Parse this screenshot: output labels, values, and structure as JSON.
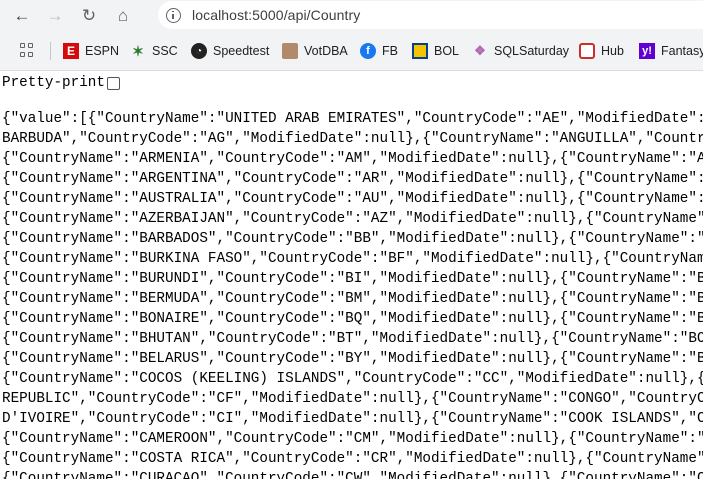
{
  "browser": {
    "url": "localhost:5000/api/Country",
    "nav": {
      "back_glyph": "←",
      "forward_glyph": "→",
      "reload_glyph": "↻",
      "home_glyph": "⌂"
    }
  },
  "bookmarks": [
    {
      "label": "ESPN",
      "icon": "espn-icon",
      "glyph": "E"
    },
    {
      "label": "SSC",
      "icon": "ssc-icon",
      "glyph": "✶"
    },
    {
      "label": "Speedtest",
      "icon": "speedtest-icon",
      "glyph": "◔"
    },
    {
      "label": "VotDBA",
      "icon": "votdba-icon",
      "glyph": ""
    },
    {
      "label": "FB",
      "icon": "facebook-icon",
      "glyph": "f"
    },
    {
      "label": "BOL",
      "icon": "bol-icon",
      "glyph": ""
    },
    {
      "label": "SQLSaturday",
      "icon": "sqlsaturday-icon",
      "glyph": "❖"
    },
    {
      "label": "Hub",
      "icon": "hub-icon",
      "glyph": ""
    },
    {
      "label": "Fantasy",
      "icon": "yahoo-fantasy-icon",
      "glyph": "y!"
    }
  ],
  "page": {
    "pretty_print_label": "Pretty-print",
    "pretty_print_checked": false,
    "json_lines": [
      "{\"value\":[{\"CountryName\":\"UNITED ARAB EMIRATES\",\"CountryCode\":\"AE\",\"ModifiedDate\":null},{\"CountryName\":\"ANTIGUA AND",
      "BARBUDA\",\"CountryCode\":\"AG\",\"ModifiedDate\":null},{\"CountryName\":\"ANGUILLA\",\"CountryCode\":\"AI\",\"ModifiedDate\":null},",
      "{\"CountryName\":\"ARMENIA\",\"CountryCode\":\"AM\",\"ModifiedDate\":null},{\"CountryName\":\"ANGOLA\",\"CountryCode\":\"AO\"",
      "{\"CountryName\":\"ARGENTINA\",\"CountryCode\":\"AR\",\"ModifiedDate\":null},{\"CountryName\":\"AUSTRIA\",\"CountryCode\"",
      "{\"CountryName\":\"AUSTRALIA\",\"CountryCode\":\"AU\",\"ModifiedDate\":null},{\"CountryName\":\"ARUBA\",\"CountryCode\"",
      "{\"CountryName\":\"AZERBAIJAN\",\"CountryCode\":\"AZ\",\"ModifiedDate\":null},{\"CountryName\":\"BANGLADESH\",\"Country",
      "{\"CountryName\":\"BARBADOS\",\"CountryCode\":\"BB\",\"ModifiedDate\":null},{\"CountryName\":\"BELGIUM\",\"CountryCode\"",
      "{\"CountryName\":\"BURKINA FASO\",\"CountryCode\":\"BF\",\"ModifiedDate\":null},{\"CountryName\":\"BULGARIA\",\"Country",
      "{\"CountryName\":\"BURUNDI\",\"CountryCode\":\"BI\",\"ModifiedDate\":null},{\"CountryName\":\"BENIN\",\"CountryCode\"",
      "{\"CountryName\":\"BERMUDA\",\"CountryCode\":\"BM\",\"ModifiedDate\":null},{\"CountryName\":\"BRUNEI\",\"CountryCode\"",
      "{\"CountryName\":\"BONAIRE\",\"CountryCode\":\"BQ\",\"ModifiedDate\":null},{\"CountryName\":\"BRAZIL\",\"CountryCode\"",
      "{\"CountryName\":\"BHUTAN\",\"CountryCode\":\"BT\",\"ModifiedDate\":null},{\"CountryName\":\"BOTSWANA\",\"CountryCode\"",
      "{\"CountryName\":\"BELARUS\",\"CountryCode\":\"BY\",\"ModifiedDate\":null},{\"CountryName\":\"BELIZE\",\"CountryCode\"",
      "{\"CountryName\":\"COCOS (KEELING) ISLANDS\",\"CountryCode\":\"CC\",\"ModifiedDate\":null},{\"CountryName\":\"CENTRAL AFRICAN",
      "REPUBLIC\",\"CountryCode\":\"CF\",\"ModifiedDate\":null},{\"CountryName\":\"CONGO\",\"CountryCode\":\"CG\",\"ModifiedDate\":null},{\"CountryName\":\"COTE",
      "D'IVOIRE\",\"CountryCode\":\"CI\",\"ModifiedDate\":null},{\"CountryName\":\"COOK ISLANDS\",\"CountryCode\":\"CK\"",
      "{\"CountryName\":\"CAMEROON\",\"CountryCode\":\"CM\",\"ModifiedDate\":null},{\"CountryName\":\"CHINA\",\"CountryCode\"",
      "{\"CountryName\":\"COSTA RICA\",\"CountryCode\":\"CR\",\"ModifiedDate\":null},{\"CountryName\":\"CUBA\",\"CountryCode\"",
      "{\"CountryName\":\"CURACAO\",\"CountryCode\":\"CW\",\"ModifiedDate\":null},{\"CountryName\":\"CYPRUS\",\"CountryCode\""
    ]
  }
}
